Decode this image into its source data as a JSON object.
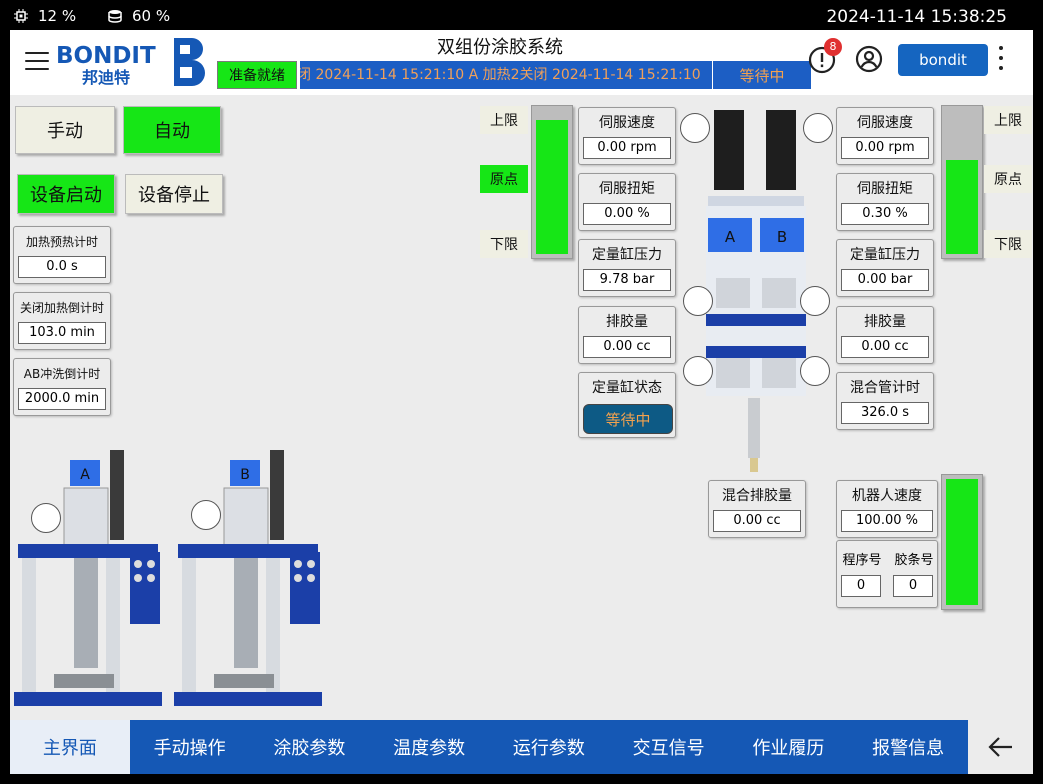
{
  "status_bar": {
    "cpu": "12 %",
    "disk": "60 %",
    "datetime": "2024-11-14 15:38:25"
  },
  "header": {
    "title": "双组份涂胶系统",
    "logo_text": "BONDIT",
    "logo_sub": "邦迪特",
    "ready_status": "准备就绪",
    "ticker": "闭 2024-11-14 15:21:10  A 加热2关闭 2024-11-14 15:21:10",
    "wait_status": "等待中",
    "alarm_count": "8",
    "user": "bondit"
  },
  "mode_buttons": {
    "manual": "手动",
    "auto": "自动",
    "start": "设备启动",
    "stop": "设备停止"
  },
  "timers": [
    {
      "label": "加热预热计时",
      "value": "0.0 s"
    },
    {
      "label": "关闭加热倒计时",
      "value": "103.0 min"
    },
    {
      "label": "AB冲洗倒计时",
      "value": "2000.0 min"
    }
  ],
  "limits_left": {
    "upper": "上限",
    "home": "原点",
    "lower": "下限",
    "level_pct": 93
  },
  "limits_right": {
    "upper": "上限",
    "home": "原点",
    "lower": "下限",
    "level_pct": 65
  },
  "left_params": {
    "servo_speed": {
      "label": "伺服速度",
      "value": "0.00 rpm"
    },
    "servo_torque": {
      "label": "伺服扭矩",
      "value": "0.00 %"
    },
    "meter_pressure": {
      "label": "定量缸压力",
      "value": "9.78 bar"
    },
    "dispense_vol": {
      "label": "排胶量",
      "value": "0.00 cc"
    },
    "meter_state": {
      "label": "定量缸状态",
      "value": "等待中"
    }
  },
  "right_params": {
    "servo_speed": {
      "label": "伺服速度",
      "value": "0.00 rpm"
    },
    "servo_torque": {
      "label": "伺服扭矩",
      "value": "0.30 %"
    },
    "meter_pressure": {
      "label": "定量缸压力",
      "value": "0.00 bar"
    },
    "dispense_vol": {
      "label": "排胶量",
      "value": "0.00 cc"
    },
    "mix_timer": {
      "label": "混合管计时",
      "value": "326.0 s"
    }
  },
  "mix_dispense": {
    "label": "混合排胶量",
    "value": "0.00 cc"
  },
  "robot": {
    "speed_label": "机器人速度",
    "speed_value": "100.00 %",
    "program_label": "程序号",
    "program_value": "0",
    "bead_label": "胶条号",
    "bead_value": "0",
    "level_pct": 100
  },
  "machine_labels": {
    "a": "A",
    "b": "B"
  },
  "nav": [
    "主界面",
    "手动操作",
    "涂胶参数",
    "温度参数",
    "运行参数",
    "交互信号",
    "作业履历",
    "报警信息"
  ],
  "colors": {
    "green": "#16e616",
    "blue": "#1558b5",
    "ticker_text": "#f0a05a"
  }
}
